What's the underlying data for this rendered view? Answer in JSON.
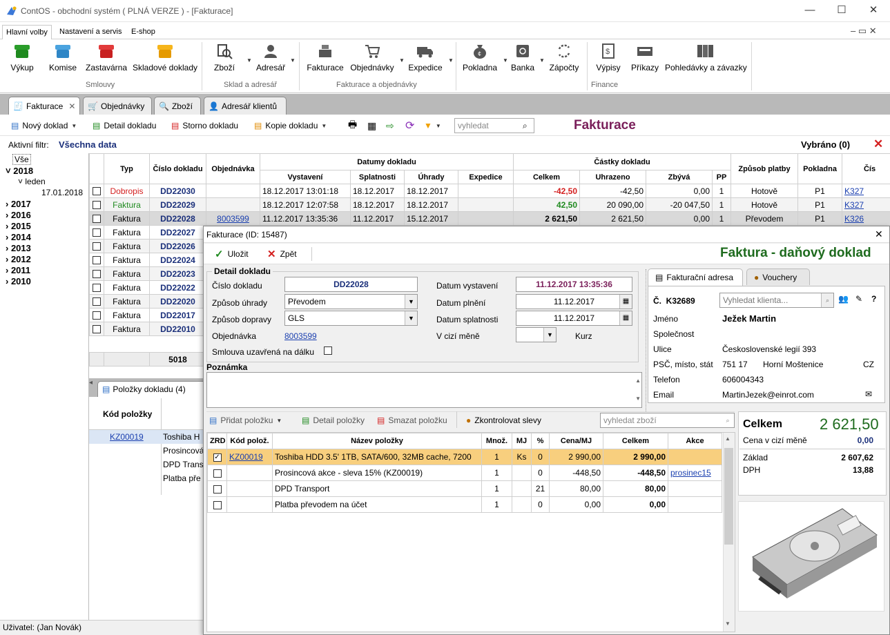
{
  "window": {
    "title": "ContOS - obchodní systém   ( PLNÁ VERZE ) - [Fakturace]",
    "min": "—",
    "max": "☐",
    "close": "✕"
  },
  "ribbon_tabs": [
    "Hlavní volby",
    "Nastavení a servis",
    "E-shop"
  ],
  "ribbon": {
    "buttons": [
      "Výkup",
      "Komise",
      "Zastavárna",
      "Skladové doklady",
      "Zboží",
      "Adresář",
      "Fakturace",
      "Objednávky",
      "Expedice",
      "Pokladna",
      "Banka",
      "Zápočty",
      "Výpisy",
      "Příkazy",
      "Pohledávky a závazky"
    ],
    "groups": [
      "Smlouvy",
      "Sklad a adresář",
      "Fakturace a objednávky",
      "Finance"
    ]
  },
  "doc_tabs": [
    "Fakturace",
    "Objednávky",
    "Zboží",
    "Adresář klientů"
  ],
  "toolbar": {
    "new": "Nový doklad",
    "detail": "Detail dokladu",
    "storno": "Storno dokladu",
    "copy": "Kopie dokladu",
    "search_placeholder": "vyhledat",
    "title": "Fakturace"
  },
  "filter": {
    "label": "Aktivní filtr:",
    "value": "Všechna data",
    "selected": "Vybráno (0)"
  },
  "tree": {
    "all": "Vše",
    "y2018": "2018",
    "month": "leden",
    "date": "17.01.2018",
    "years": [
      "2017",
      "2016",
      "2015",
      "2014",
      "2013",
      "2012",
      "2011",
      "2010"
    ]
  },
  "grid": {
    "headers": {
      "typ": "Typ",
      "cislo": "Číslo dokladu",
      "objednavka": "Objednávka",
      "datumy": "Datumy dokladu",
      "castky": "Částky dokladu",
      "vystaveni": "Vystavení",
      "splatnosti": "Splatnosti",
      "uhrady": "Úhrady",
      "expedice": "Expedice",
      "celkem": "Celkem",
      "uhrazeno": "Uhrazeno",
      "zbyva": "Zbývá",
      "pp": "PP",
      "zpusob": "Způsob platby",
      "pokladna": "Pokladna",
      "cis": "Čís"
    },
    "rows": [
      {
        "typ": "Dobropis",
        "cislo": "DD22030",
        "obj": "",
        "vyst": "18.12.2017 13:01:18",
        "splat": "18.12.2017",
        "uhr": "18.12.2017",
        "celkem": "-42,50",
        "uhrazeno": "-42,50",
        "zbyva": "0,00",
        "pp": "1",
        "zpusob": "Hotově",
        "pokl": "P1",
        "cis": "K327"
      },
      {
        "typ": "Faktura",
        "cislo": "DD22029",
        "obj": "",
        "vyst": "18.12.2017 12:07:58",
        "splat": "18.12.2017",
        "uhr": "18.12.2017",
        "celkem": "42,50",
        "uhrazeno": "20 090,00",
        "zbyva": "-20 047,50",
        "pp": "1",
        "zpusob": "Hotově",
        "pokl": "P1",
        "cis": "K327"
      },
      {
        "typ": "Faktura",
        "cislo": "DD22028",
        "obj": "8003599",
        "vyst": "11.12.2017 13:35:36",
        "splat": "11.12.2017",
        "uhr": "15.12.2017",
        "celkem": "2 621,50",
        "uhrazeno": "2 621,50",
        "zbyva": "0,00",
        "pp": "1",
        "zpusob": "Převodem",
        "pokl": "P1",
        "cis": "K326"
      },
      {
        "typ": "Faktura",
        "cislo": "DD22027"
      },
      {
        "typ": "Faktura",
        "cislo": "DD22026"
      },
      {
        "typ": "Faktura",
        "cislo": "DD22024"
      },
      {
        "typ": "Faktura",
        "cislo": "DD22023"
      },
      {
        "typ": "Faktura",
        "cislo": "DD22022"
      },
      {
        "typ": "Faktura",
        "cislo": "DD22020"
      },
      {
        "typ": "Faktura",
        "cislo": "DD22017"
      },
      {
        "typ": "Faktura",
        "cislo": "DD22010"
      }
    ],
    "total_count": "5018"
  },
  "items_panel": {
    "tab": "Položky dokladu  (4)",
    "header": "Kód položky",
    "codes": [
      "KZ00019",
      "Prosincová",
      "DPD Transp",
      "Platba přev"
    ],
    "texts": [
      "Toshiba H",
      "Prosincová",
      "DPD Trans",
      "Platba pře"
    ]
  },
  "status": "Uživatel: (Jan Novák)",
  "dialog": {
    "title": "Fakturace  (ID: 15487)",
    "save": "Uložit",
    "back": "Zpět",
    "heading": "Faktura - daňový doklad",
    "detail_group": "Detail dokladu",
    "labels": {
      "cislo": "Číslo dokladu",
      "uhrady": "Způsob úhrady",
      "dopravy": "Způsob dopravy",
      "objednavka": "Objednávka",
      "smlouva": "Smlouva uzavřená na dálku",
      "vystaveni": "Datum vystavení",
      "plneni": "Datum plnění",
      "splatnosti": "Datum splatnosti",
      "mena": "V cizí měně",
      "kurz": "Kurz",
      "poznamka": "Poznámka"
    },
    "values": {
      "cislo": "DD22028",
      "uhrady": "Převodem",
      "dopravy": "GLS",
      "objednavka": "8003599",
      "vystaveni": "11.12.2017 13:35:36",
      "plneni": "11.12.2017",
      "splatnosti": "11.12.2017"
    },
    "addr_tabs": [
      "Fakturační adresa",
      "Vouchery"
    ],
    "addr": {
      "c_label": "Č.",
      "c_value": "K32689",
      "search_placeholder": "Vyhledat klienta...",
      "jmeno_l": "Jméno",
      "jmeno": "Ježek Martin",
      "spol_l": "Společnost",
      "ulice_l": "Ulice",
      "ulice": "Československé legií 393",
      "psc_l": "PSČ, místo, stát",
      "psc": "751 17",
      "misto": "Horní Moštenice",
      "stat": "CZ",
      "tel_l": "Telefon",
      "tel": "606004343",
      "email_l": "Email",
      "email": "MartinJezek@einrot.com"
    },
    "items_toolbar": {
      "add": "Přidat položku",
      "detail": "Detail položky",
      "delete": "Smazat položku",
      "check": "Zkontrolovat slevy",
      "search_placeholder": "vyhledat zboží"
    },
    "items_headers": {
      "zrd": "ZRD",
      "kod": "Kód polož.",
      "nazev": "Název položky",
      "mnoz": "Množ.",
      "mj": "MJ",
      "pct": "%",
      "cena": "Cena/MJ",
      "celkem": "Celkem",
      "akce": "Akce"
    },
    "items": [
      {
        "kod": "KZ00019",
        "nazev": "Toshiba HDD 3.5' 1TB, SATA/600, 32MB cache, 7200",
        "mnoz": "1",
        "mj": "Ks",
        "pct": "0",
        "cena": "2 990,00",
        "celkem": "2 990,00",
        "akce": ""
      },
      {
        "kod": "",
        "nazev": "Prosincová akce - sleva 15% (KZ00019)",
        "mnoz": "1",
        "mj": "",
        "pct": "0",
        "cena": "-448,50",
        "celkem": "-448,50",
        "akce": "prosinec15"
      },
      {
        "kod": "",
        "nazev": "DPD Transport",
        "mnoz": "1",
        "mj": "",
        "pct": "21",
        "cena": "80,00",
        "celkem": "80,00",
        "akce": ""
      },
      {
        "kod": "",
        "nazev": "Platba převodem na účet",
        "mnoz": "1",
        "mj": "",
        "pct": "0",
        "cena": "0,00",
        "celkem": "0,00",
        "akce": ""
      }
    ],
    "summary": {
      "celkem_l": "Celkem",
      "celkem": "2 621,50",
      "mena_l": "Cena v cizí měně",
      "mena": "0,00",
      "zaklad_l": "Základ",
      "zaklad": "2 607,62",
      "dph_l": "DPH",
      "dph": "13,88"
    }
  },
  "colors": {
    "accent_purple": "#7a1f5a",
    "heading_green": "#1e6b1e",
    "navy": "#1a2f7a",
    "red": "#d42020",
    "green": "#1f8a1f",
    "selected_row": "#f8cf7e"
  }
}
